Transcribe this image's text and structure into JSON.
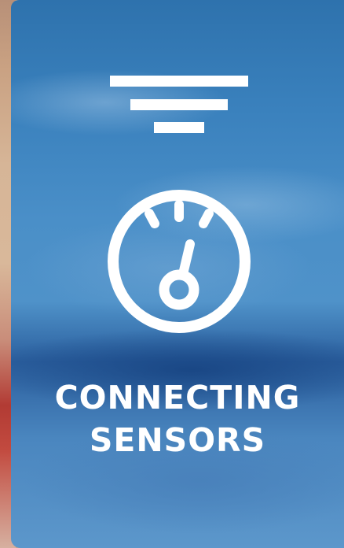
{
  "card": {
    "title_line1": "CONNECTING",
    "title_line2": "SENSORS",
    "icons": {
      "top": "filter-icon",
      "main": "gauge-icon"
    },
    "colors": {
      "accent": "#4a8fc8",
      "text": "#ffffff"
    }
  }
}
